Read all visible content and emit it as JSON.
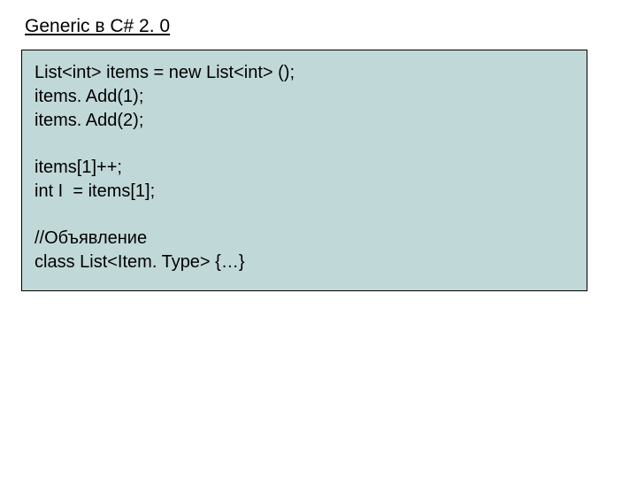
{
  "slide": {
    "title": "Generic в C# 2. 0",
    "code": {
      "line1": "List<int> items = new List<int> ();",
      "line2": "items. Add(1);",
      "line3": "items. Add(2);",
      "line4": "items[1]++;",
      "line5": "int I  = items[1];",
      "line6": "//Объявление",
      "line7": "class List<Item. Type> {…}"
    }
  }
}
